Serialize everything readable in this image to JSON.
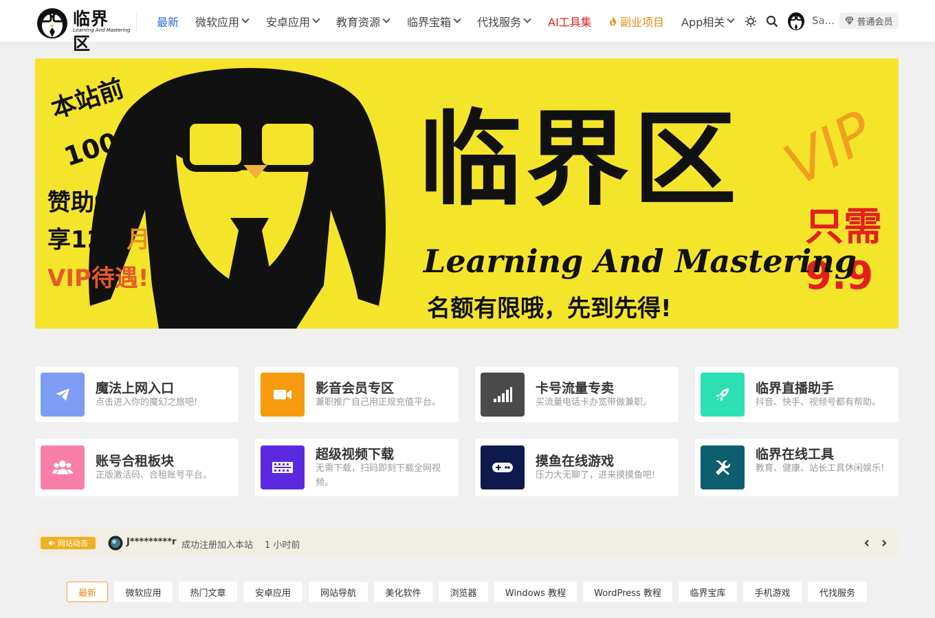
{
  "header": {
    "logo_name": "临界区",
    "logo_tagline": "Learning And Mastering",
    "nav": [
      {
        "label": "最新",
        "color": "#2a6ed6",
        "dropdown": false
      },
      {
        "label": "微软应用",
        "color": "#444444",
        "dropdown": true
      },
      {
        "label": "安卓应用",
        "color": "#444444",
        "dropdown": true
      },
      {
        "label": "教育资源",
        "color": "#444444",
        "dropdown": true
      },
      {
        "label": "临界宝箱",
        "color": "#444444",
        "dropdown": true
      },
      {
        "label": "代找服务",
        "color": "#444444",
        "dropdown": true
      },
      {
        "label": "AI工具集",
        "color": "#e02020",
        "dropdown": false
      },
      {
        "label": "副业项目",
        "color": "#e8890f",
        "dropdown": false,
        "icon": "flame-icon"
      },
      {
        "label": "App相关",
        "color": "#444444",
        "dropdown": true
      }
    ],
    "user_name": "Sa...",
    "member_label": "普通会员"
  },
  "banner": {
    "left_line1": "本站前",
    "left_line2": "100名!",
    "left_line3": "赞助9.9",
    "left_line4_a": "享12个",
    "left_line4_b": "月",
    "left_line5": "VIP待遇!",
    "title": "临界区",
    "vip": "VIP",
    "price_label": "只需",
    "price": "9.9",
    "tagline": "Learning And Mastering",
    "subline": "名额有限哦，先到先得!"
  },
  "cards": [
    {
      "title": "魔法上网入口",
      "desc": "点击进入你的魔幻之旅吧!",
      "color": "#7f9cf5",
      "icon": "paper-plane-icon"
    },
    {
      "title": "影音会员专区",
      "desc": "兼职推广自己用正规充值平台。",
      "color": "#f79a0f",
      "icon": "video-camera-icon"
    },
    {
      "title": "卡号流量专卖",
      "desc": "买流量电话卡办宽带做兼职。",
      "color": "#4a4a4a",
      "icon": "signal-bars-icon"
    },
    {
      "title": "临界直播助手",
      "desc": "抖音、快手、视频号都有帮助。",
      "color": "#2de0b4",
      "icon": "rocket-icon"
    },
    {
      "title": "账号合租板块",
      "desc": "正版激活码、合租账号平台。",
      "color": "#f97fa8",
      "icon": "users-icon"
    },
    {
      "title": "超级视频下载",
      "desc": "无需下载，扫码即刻下载全网视频。",
      "color": "#5b2ae0",
      "icon": "film-strip-icon"
    },
    {
      "title": "摸鱼在线游戏",
      "desc": "压力大无聊了，进来摸摸鱼吧!",
      "color": "#0e1a4d",
      "icon": "gamepad-icon"
    },
    {
      "title": "临界在线工具",
      "desc": "教育、健康、站长工具休闲娱乐!",
      "color": "#0d5e6e",
      "icon": "tools-icon"
    }
  ],
  "ticker": {
    "badge": "网站动态",
    "user": "J*********r",
    "message": "成功注册加入本站",
    "time": "1 小时前"
  },
  "tabs": [
    "最新",
    "微软应用",
    "热门文章",
    "安卓应用",
    "网站导航",
    "美化软件",
    "浏览器",
    "Windows 教程",
    "WordPress 教程",
    "临界宝库",
    "手机游戏",
    "代找服务"
  ]
}
